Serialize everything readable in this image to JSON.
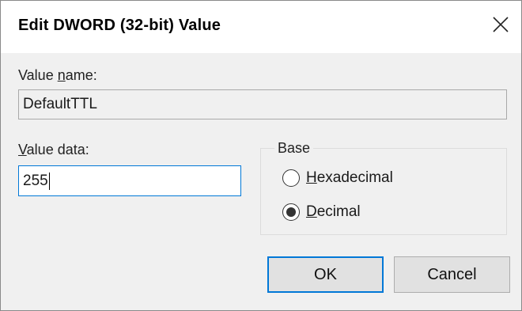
{
  "window": {
    "title": "Edit DWORD (32-bit) Value",
    "close_icon": "close-icon"
  },
  "value_name": {
    "label_prefix": "Value ",
    "label_underlined": "n",
    "label_suffix": "ame:",
    "value": "DefaultTTL"
  },
  "value_data": {
    "label_underlined": "V",
    "label_suffix": "alue data:",
    "value": "255"
  },
  "base": {
    "title": "Base",
    "options": [
      {
        "underlined": "H",
        "rest": "exadecimal",
        "selected": false
      },
      {
        "underlined": "D",
        "rest": "ecimal",
        "selected": true
      }
    ]
  },
  "buttons": {
    "ok": "OK",
    "cancel": "Cancel"
  },
  "colors": {
    "accent": "#0078d7",
    "dialog_bg": "#f0f0f0"
  }
}
